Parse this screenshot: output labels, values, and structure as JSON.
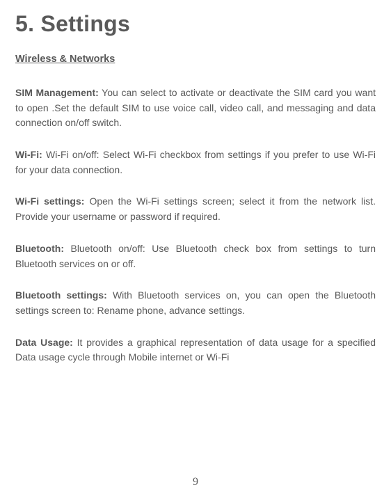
{
  "heading": "5. Settings",
  "subheading": "Wireless & Networks",
  "sections": [
    {
      "label": "SIM Management:",
      "text": " You can select to activate or deactivate the SIM card you want to open .Set the default SIM to use voice call, video call, and messaging and data connection on/off switch."
    },
    {
      "label": "Wi-Fi:",
      "text": " Wi-Fi on/off: Select Wi-Fi checkbox from settings if you prefer to use Wi-Fi for your data connection."
    },
    {
      "label": "Wi-Fi settings:",
      "text": " Open the Wi-Fi settings screen; select it from the network list. Provide your username or password if required."
    },
    {
      "label": "Bluetooth:",
      "text": " Bluetooth on/off: Use Bluetooth check box from settings to turn Bluetooth services on or off."
    },
    {
      "label": "Bluetooth settings:",
      "text": " With Bluetooth services on, you can open the Bluetooth settings screen to: Rename phone, advance settings."
    },
    {
      "label": "Data Usage:",
      "text": " It provides a graphical representation of data usage for a specified Data usage cycle through Mobile internet or Wi-Fi"
    }
  ],
  "pageNumber": "9"
}
